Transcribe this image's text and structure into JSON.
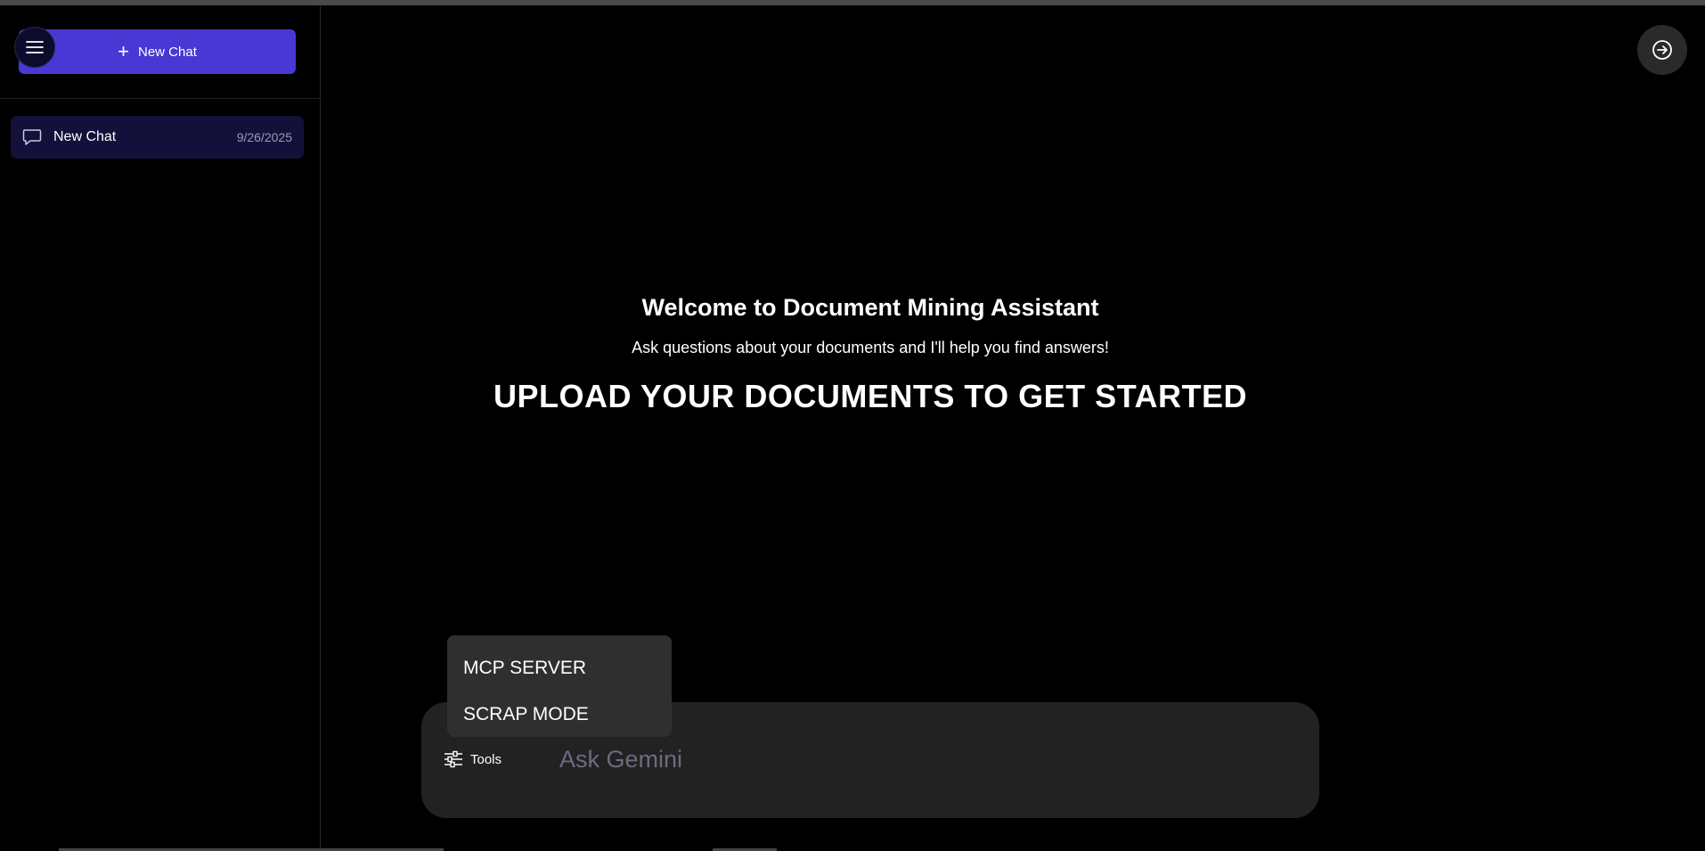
{
  "sidebar": {
    "new_chat_label": "New Chat",
    "chats": [
      {
        "label": "New Chat",
        "date": "9/26/2025"
      }
    ]
  },
  "main": {
    "welcome_title": "Welcome to Document Mining Assistant",
    "welcome_subtitle": "Ask questions about your documents and I'll help you find answers!",
    "welcome_cta": "UPLOAD YOUR DOCUMENTS TO GET STARTED"
  },
  "composer": {
    "tools_label": "Tools",
    "placeholder": "Ask Gemini"
  },
  "tools_menu": {
    "items": [
      {
        "label": "MCP SERVER"
      },
      {
        "label": "SCRAP MODE"
      }
    ]
  },
  "colors": {
    "accent": "#4a38d4",
    "chat_item_bg": "#13113a",
    "background": "#000000",
    "input_bg": "#222222"
  },
  "icons": [
    "menu-icon",
    "plus-icon",
    "chat-bubble-icon",
    "logout-icon",
    "sliders-icon"
  ]
}
